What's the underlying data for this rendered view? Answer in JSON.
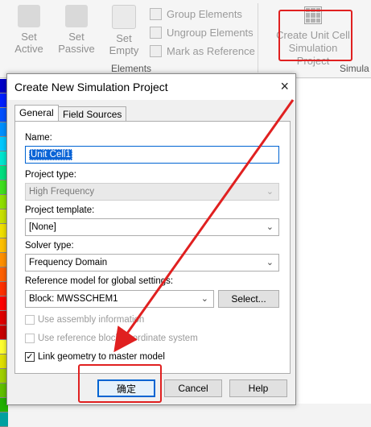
{
  "ribbon": {
    "set_active": "Set\nActive",
    "set_passive": "Set\nPassive",
    "set_empty": "Set\nEmpty",
    "group_elements": "Group Elements",
    "ungroup_elements": "Ungroup Elements",
    "mark_as_reference": "Mark as Reference",
    "group_label": "Elements",
    "create_unit_cell": "Create Unit Cell\nSimulation Project",
    "group_label2": "Simula"
  },
  "dialog": {
    "title": "Create New Simulation Project",
    "close": "×",
    "tabs": [
      "General",
      "Field Sources"
    ],
    "name_label": "Name:",
    "name_value": "Unit Cell1",
    "project_type_label": "Project type:",
    "project_type_value": "High Frequency",
    "project_template_label": "Project template:",
    "project_template_value": "[None]",
    "solver_type_label": "Solver type:",
    "solver_type_value": "Frequency Domain",
    "reference_label": "Reference model for global settings:",
    "reference_value": "Block: MWSSCHEM1",
    "select_button": "Select...",
    "use_assembly_info": "Use assembly information",
    "use_reference_block": "Use reference block coordinate system",
    "link_geometry": "Link geometry to master model",
    "ok_button": "确定",
    "cancel_button": "Cancel",
    "help_button": "Help"
  },
  "colors": {
    "highlight": "#e02020",
    "selection": "#0a64d6",
    "colorbar": [
      "#0000c8",
      "#0020ff",
      "#0050ff",
      "#0090ff",
      "#00c8ff",
      "#00e6d0",
      "#00e080",
      "#40e020",
      "#90e000",
      "#c8e000",
      "#f0e000",
      "#ffc000",
      "#ff9000",
      "#ff6000",
      "#ff3000",
      "#ff0000",
      "#e00000",
      "#c80000",
      "#ffff30",
      "#e0e000",
      "#a0d000",
      "#60c000",
      "#20b000",
      "#00a0a0"
    ]
  }
}
